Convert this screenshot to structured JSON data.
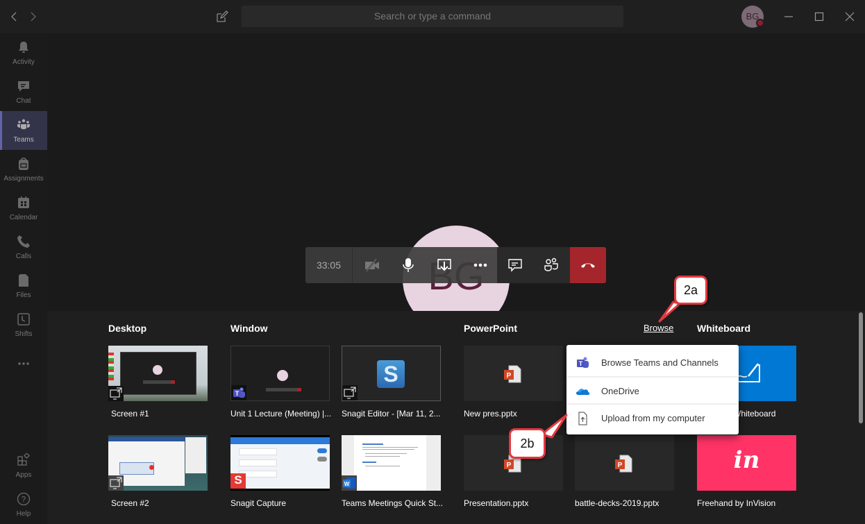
{
  "titlebar": {
    "search_placeholder": "Search or type a command",
    "user_initials": "BG",
    "icons": [
      "back-icon",
      "forward-icon",
      "compose-icon",
      "minimize-icon",
      "maximize-icon",
      "close-icon"
    ]
  },
  "rail": {
    "items": [
      {
        "label": "Activity",
        "icon": "bell-icon"
      },
      {
        "label": "Chat",
        "icon": "chat-icon"
      },
      {
        "label": "Teams",
        "icon": "teams-icon",
        "active": true
      },
      {
        "label": "Assignments",
        "icon": "backpack-icon"
      },
      {
        "label": "Calendar",
        "icon": "calendar-icon"
      },
      {
        "label": "Calls",
        "icon": "phone-icon"
      },
      {
        "label": "Files",
        "icon": "file-icon"
      },
      {
        "label": "Shifts",
        "icon": "clock-icon"
      },
      {
        "label": "...",
        "icon": "more-icon"
      }
    ],
    "bottom": [
      {
        "label": "Apps",
        "icon": "apps-icon"
      },
      {
        "label": "Help",
        "icon": "help-icon"
      }
    ]
  },
  "call": {
    "participant_initials": "BG",
    "timer": "33:05",
    "buttons": [
      "camera-off",
      "microphone",
      "share-tray",
      "more-actions",
      "conversation",
      "participants",
      "hang-up"
    ],
    "colors": {
      "hangup": "#a4262c",
      "avatar_bg": "#e8d3e0"
    }
  },
  "share_tray": {
    "sections": {
      "desktop": "Desktop",
      "window": "Window",
      "powerpoint": "PowerPoint",
      "browse": "Browse",
      "whiteboard": "Whiteboard"
    },
    "desktop": [
      {
        "label": "Screen #1"
      },
      {
        "label": "Screen #2"
      }
    ],
    "window": [
      {
        "label": "Unit 1 Lecture (Meeting) |..."
      },
      {
        "label": "Snagit Editor - [Mar 11, 2..."
      },
      {
        "label": "Snagit Capture"
      },
      {
        "label": "Teams Meetings Quick St..."
      }
    ],
    "powerpoint": [
      {
        "label": "New pres.pptx"
      },
      {
        "label": "Presentation.pptx"
      },
      {
        "label": "battle-decks-2019.pptx"
      }
    ],
    "whiteboard": [
      {
        "label": "Microsoft Whiteboard",
        "visible_label": "Whiteboard",
        "color": "#0078d4"
      },
      {
        "label": "Freehand by InVision",
        "color": "#ff3366",
        "logo_text": "in"
      }
    ]
  },
  "browse_menu": {
    "items": [
      {
        "label": "Browse Teams and Channels",
        "icon": "teams-logo-icon"
      },
      {
        "label": "OneDrive",
        "icon": "onedrive-icon"
      },
      {
        "label": "Upload from my computer",
        "icon": "upload-file-icon"
      }
    ]
  },
  "annotations": {
    "callout_a": "2a",
    "callout_b": "2b",
    "color": "#e5383f"
  }
}
